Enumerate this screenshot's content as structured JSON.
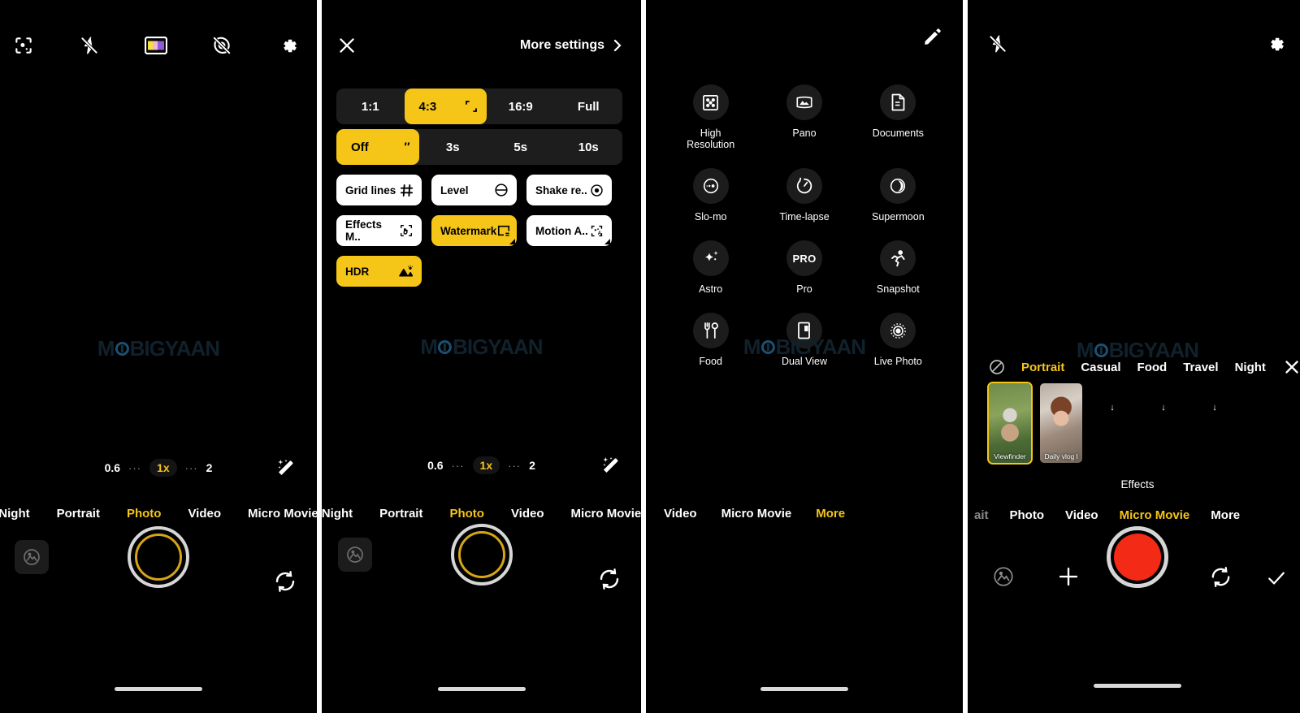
{
  "watermark": "MOBIGYAAN",
  "panel1": {
    "name": "camera-photo-viewfinder",
    "topbar": [
      {
        "name": "ai-scene-icon",
        "label": "AI scene detection"
      },
      {
        "name": "flash-off-icon",
        "label": "Flash off"
      },
      {
        "name": "filter-icon",
        "label": "Color filters"
      },
      {
        "name": "live-photo-off-icon",
        "label": "Live photo off"
      },
      {
        "name": "gear-icon",
        "label": "Settings"
      }
    ],
    "zoom": {
      "levels": [
        "0.6",
        "1x",
        "2"
      ],
      "active": "1x",
      "dots": "···"
    },
    "beauty_icon": "magic-wand-icon",
    "modes": [
      "Night",
      "Portrait",
      "Photo",
      "Video",
      "Micro Movie"
    ],
    "active_mode": "Photo",
    "controls": {
      "gallery": "gallery-thumbnail",
      "shutter": "shutter-button",
      "flip": "flip-camera-icon"
    }
  },
  "panel2": {
    "name": "camera-settings-sheet",
    "close_label": "✕",
    "more_settings": "More settings",
    "aspect_ratio": {
      "options": [
        "1:1",
        "4:3",
        "16:9",
        "Full"
      ],
      "selected": "4:3"
    },
    "timer": {
      "options": [
        "Off",
        "3s",
        "5s",
        "10s"
      ],
      "selected": "Off"
    },
    "toggles": [
      {
        "label": "Grid lines",
        "icon": "grid-icon",
        "on": false
      },
      {
        "label": "Level",
        "icon": "level-icon",
        "on": false
      },
      {
        "label": "Shake re..",
        "icon": "shake-reduction-icon",
        "on": false
      },
      {
        "label": "Effects M..",
        "icon": "effects-menu-icon",
        "on": false
      },
      {
        "label": "Watermark",
        "icon": "watermark-icon",
        "on": true
      },
      {
        "label": "Motion A..",
        "icon": "motion-auto-icon",
        "on": false
      },
      {
        "label": "HDR",
        "icon": "hdr-icon",
        "on": true
      }
    ],
    "zoom": {
      "levels": [
        "0.6",
        "1x",
        "2"
      ],
      "active": "1x",
      "dots": "···"
    },
    "modes": [
      "Night",
      "Portrait",
      "Photo",
      "Video",
      "Micro Movie"
    ],
    "active_mode": "Photo"
  },
  "panel3": {
    "name": "more-modes-screen",
    "edit_icon": "pencil-icon",
    "modes_grid": [
      {
        "label": "High\nResolution",
        "icon": "high-resolution-icon"
      },
      {
        "label": "Pano",
        "icon": "panorama-icon"
      },
      {
        "label": "Documents",
        "icon": "documents-icon"
      },
      {
        "label": "Slo-mo",
        "icon": "slow-motion-icon"
      },
      {
        "label": "Time-lapse",
        "icon": "time-lapse-icon"
      },
      {
        "label": "Supermoon",
        "icon": "supermoon-icon"
      },
      {
        "label": "Astro",
        "icon": "astro-icon"
      },
      {
        "label": "Pro",
        "icon": "pro-icon"
      },
      {
        "label": "Snapshot",
        "icon": "snapshot-icon"
      },
      {
        "label": "Food",
        "icon": "food-icon"
      },
      {
        "label": "Dual View",
        "icon": "dual-view-icon"
      },
      {
        "label": "Live Photo",
        "icon": "live-photo-icon"
      }
    ],
    "modes": [
      "Video",
      "Micro Movie",
      "More"
    ],
    "active_mode": "More"
  },
  "panel4": {
    "name": "micro-movie-effects-screen",
    "topbar": [
      {
        "name": "flash-off-icon",
        "label": "Flash off"
      },
      {
        "name": "gear-icon",
        "label": "Settings"
      }
    ],
    "effect_categories": [
      "Portrait",
      "Casual",
      "Food",
      "Travel",
      "Night"
    ],
    "active_category": "Portrait",
    "no_effect_icon": "no-effect-icon",
    "close_icon": "close-icon",
    "effect_cards": [
      {
        "caption": "Viewfinder",
        "selected": true
      },
      {
        "caption": "Daily vlog l",
        "selected": false
      }
    ],
    "effects_title": "Effects",
    "modes": [
      "ait",
      "Photo",
      "Video",
      "Micro Movie",
      "More"
    ],
    "active_mode": "Micro Movie",
    "controls": {
      "gallery": "gallery-thumbnail",
      "add": "add-icon",
      "record": "record-button",
      "flip": "flip-camera-icon",
      "confirm": "check-icon"
    },
    "record_color": "#f22a16"
  }
}
